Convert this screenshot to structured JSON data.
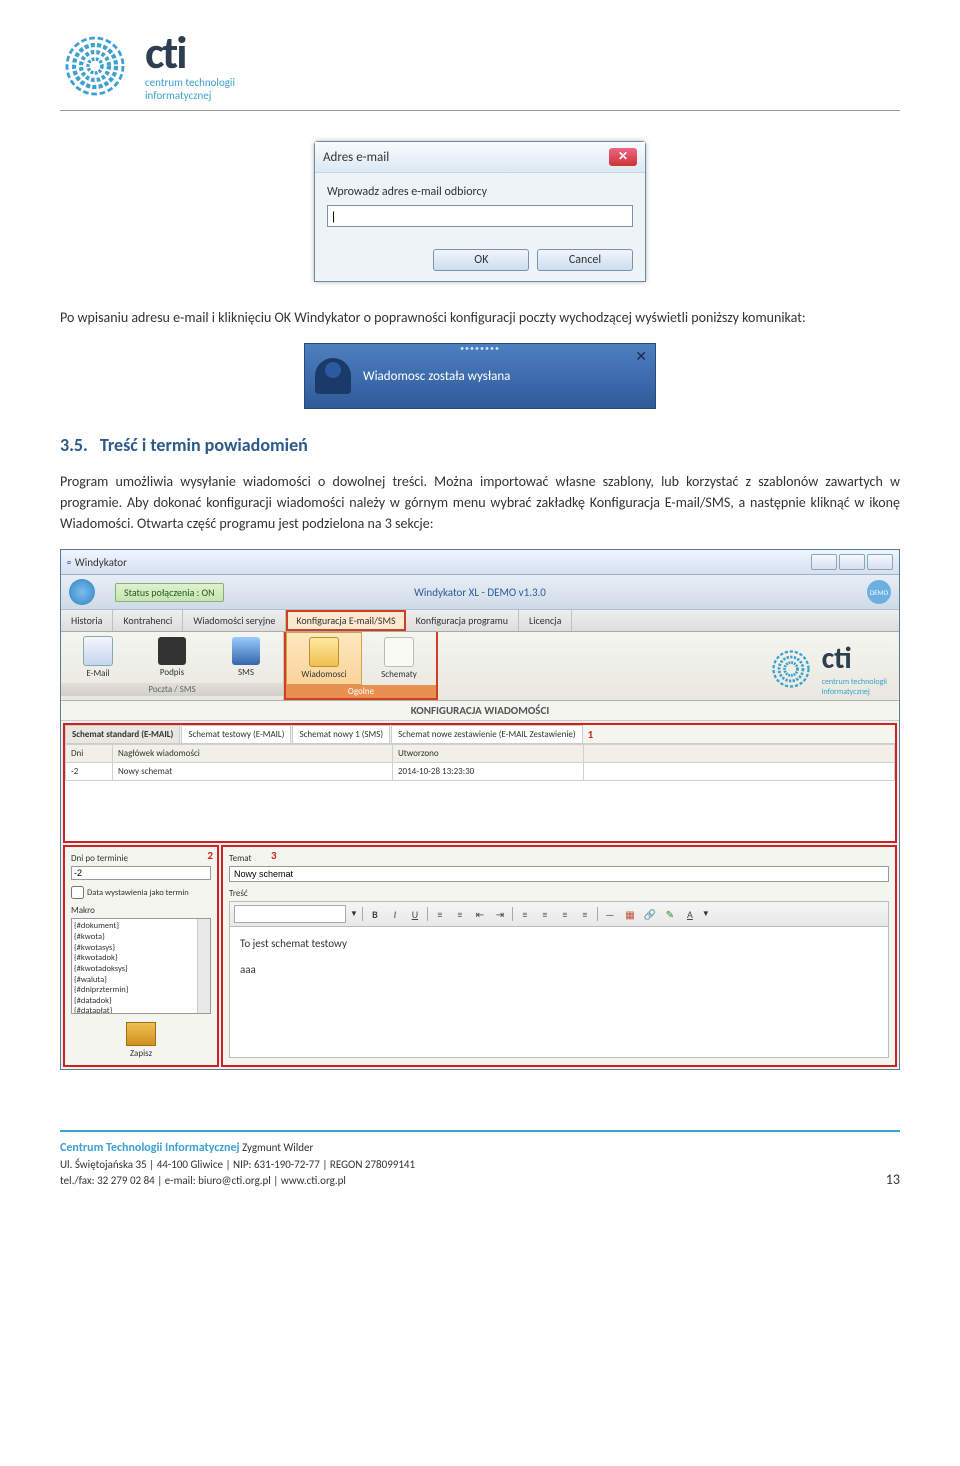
{
  "header": {
    "logo_text": "cti",
    "logo_sub1": "centrum technologii",
    "logo_sub2": "informatycznej"
  },
  "dialog": {
    "title": "Adres e-mail",
    "label": "Wprowadz adres e-mail odbiorcy",
    "input_value": "|",
    "ok": "OK",
    "cancel": "Cancel"
  },
  "para1": "Po wpisaniu adresu e-mail i kliknięciu OK Windykator o poprawności konfiguracji poczty wychodzącej wyświetli poniższy komunikat:",
  "toast": {
    "text": "Wiadomosc została wysłana"
  },
  "section35": {
    "num": "3.5.",
    "title": "Treść i termin powiadomień"
  },
  "para2": "Program umożliwia wysyłanie wiadomości o dowolnej treści. Można importować własne szablony, lub korzystać z szablonów zawartych w programie. Aby dokonać konfiguracji wiadomości należy w górnym menu wybrać zakładkę Konfiguracja E-mail/SMS, a następnie kliknąć w ikonę Wiadomości. Otwarta część programu jest podzielona na 3 sekcje:",
  "app": {
    "window_title": "Windykator",
    "status": "Status połączenia : ON",
    "product": "Windykator XL - DEMO v1.3.0",
    "demo": "DEMO",
    "menu": {
      "historia": "Historia",
      "kontrahenci": "Kontrahenci",
      "wiadomosci_ser": "Wiadomości seryjne",
      "konfig_email": "Konfiguracja E-mail/SMS",
      "konfig_prog": "Konfiguracja programu",
      "licencja": "Licencja"
    },
    "ribbon": {
      "email": "E-Mail",
      "podpis": "Podpis",
      "sms": "SMS",
      "wiadomosci": "Wiadomosci",
      "schematy": "Schematy",
      "group1": "Poczta / SMS",
      "group2": "Ogolne",
      "logo_text": "cti",
      "logo_sub1": "centrum technologii",
      "logo_sub2": "informatycznej"
    },
    "config_heading": "KONFIGURACJA WIADOMOŚCI",
    "schema_tabs": {
      "t1": "Schemat standard (E-MAIL)",
      "t2": "Schemat testowy (E-MAIL)",
      "t3": "Schemat nowy 1 (SMS)",
      "t4": "Schemat nowe zestawienie (E-MAIL Zestawienie)"
    },
    "table": {
      "col_dni": "Dni",
      "col_nag": "Nagłówek wiadomości",
      "col_utw": "Utworzono",
      "row_dni": "-2",
      "row_nag": "Nowy schemat",
      "row_utw": "2014-10-28 13:23:30"
    },
    "panel2": {
      "dni_label": "Dni po terminie",
      "dni_value": "-2",
      "checkbox": "Data wystawienia jako termin",
      "makro_label": "Makro",
      "makro_items": [
        "{#dokument}",
        "{#kwota}",
        "{#kwotasys}",
        "{#kwotadok}",
        "{#kwotadoksys}",
        "{#waluta}",
        "{#dniprztermin}",
        "{#datadok}",
        "{#datapłat}"
      ],
      "save": "Zapisz"
    },
    "panel3": {
      "temat_label": "Temat",
      "temat_value": "Nowy schemat",
      "tresc_label": "Treść",
      "body_line1": "To jest schemat testowy",
      "body_line2": "aaa"
    },
    "markers": {
      "m1": "1",
      "m2": "2",
      "m3": "3"
    }
  },
  "footer": {
    "company": "Centrum Technologii Informatycznej",
    "owner": "Zygmunt Wilder",
    "line2": "Ul. Świętojańska 35 | 44-100 Gliwice | NIP: 631-190-72-77 | REGON 278099141",
    "line3": "tel./fax: 32 279 02 84 | e-mail: biuro@cti.org.pl | www.cti.org.pl",
    "page": "13"
  }
}
